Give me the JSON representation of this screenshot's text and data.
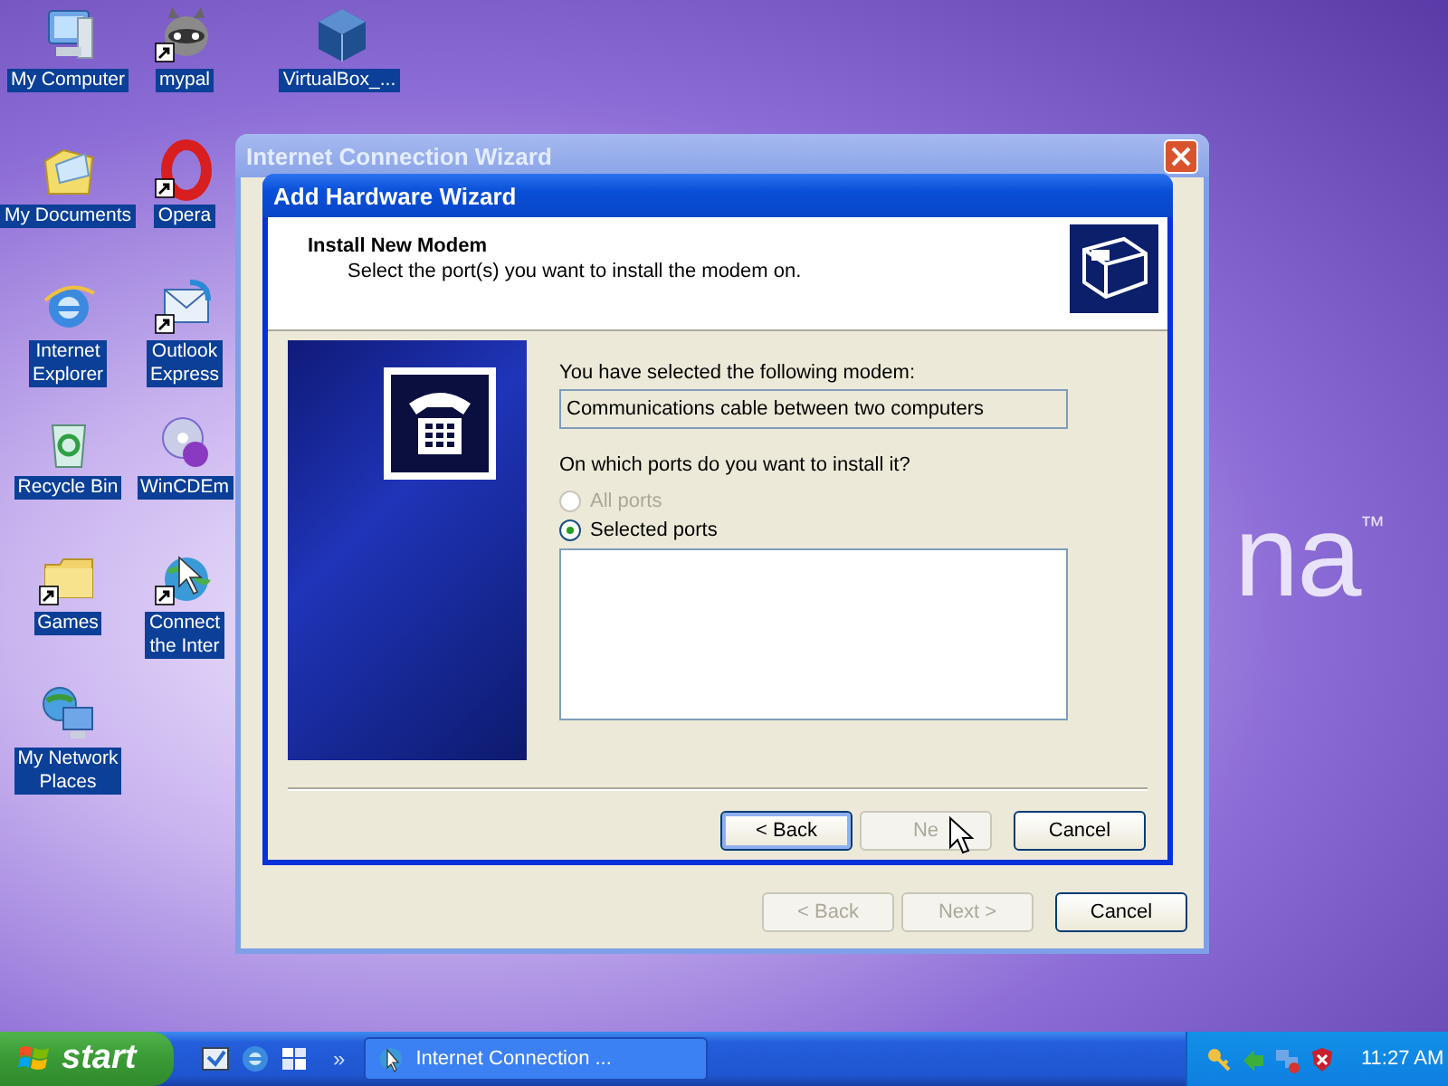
{
  "desktop": {
    "wallpaper_text": "na$^{™}$",
    "icon_columns": [
      [
        {
          "kind": "computer",
          "label": [
            "My Computer"
          ],
          "shortcut": false
        },
        {
          "kind": "documents",
          "label": [
            "My Documents"
          ],
          "shortcut": false
        },
        {
          "kind": "browser",
          "label": [
            "Internet",
            "Explorer"
          ],
          "shortcut": false
        },
        {
          "kind": "recycle",
          "label": [
            "Recycle Bin"
          ],
          "shortcut": false
        },
        {
          "kind": "folder",
          "label": [
            "Games"
          ],
          "shortcut": true
        },
        {
          "kind": "network",
          "label": [
            "My Network",
            "Places"
          ],
          "shortcut": false
        }
      ],
      [
        {
          "kind": "animal",
          "label": [
            "mypal"
          ],
          "shortcut": true
        },
        {
          "kind": "letter-o",
          "label": [
            "Opera"
          ],
          "shortcut": true
        },
        {
          "kind": "mail",
          "label": [
            "Outlook",
            "Express"
          ],
          "shortcut": true
        },
        {
          "kind": "disc",
          "label": [
            "WinCDEm"
          ],
          "shortcut": false
        },
        {
          "kind": "globe",
          "label": [
            "Connect",
            "the Inter"
          ],
          "shortcut": true
        }
      ],
      [
        {
          "kind": "cube",
          "label": [
            "VirtualBox_..."
          ],
          "shortcut": false
        }
      ]
    ]
  },
  "back_window": {
    "title": "Internet Connection Wizard",
    "buttons": [
      {
        "label": "< Back",
        "disabled": true,
        "focused": false
      },
      {
        "label": "Next >",
        "disabled": true,
        "focused": false
      },
      {
        "label": "Cancel",
        "disabled": false,
        "focused": false
      }
    ]
  },
  "wizard": {
    "title": "Add Hardware Wizard",
    "heading": "Install New Modem",
    "subheading": "Select the port(s) you want to install the modem on.",
    "modem_label": "You have selected the following modem:",
    "modem_field": "Communications cable between two computers",
    "question": "On which ports do you want to install it?",
    "port_options": [
      {
        "label": "All ports",
        "selected": false,
        "disabled": true
      },
      {
        "label": "Selected ports",
        "selected": true,
        "disabled": false
      }
    ],
    "buttons": [
      {
        "label": "< Back",
        "disabled": false,
        "focused": true
      },
      {
        "label": "Ne",
        "disabled": true,
        "focused": false
      },
      {
        "label": "Cancel",
        "disabled": false,
        "focused": false
      }
    ]
  },
  "taskbar": {
    "start": "start",
    "chevron": "»",
    "task": "Internet Connection ...",
    "clock": "11:27 AM"
  }
}
